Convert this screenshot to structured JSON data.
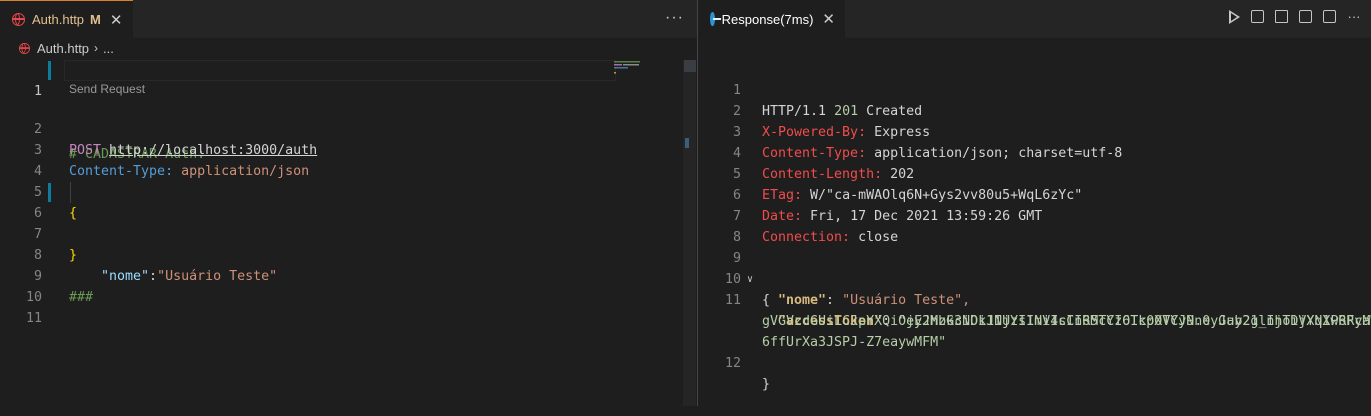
{
  "left": {
    "tab": {
      "label": "Auth.http",
      "modified": "M",
      "close": "✕"
    },
    "more": "···",
    "breadcrumb": {
      "file": "Auth.http",
      "sep": "›",
      "more": "..."
    },
    "codelens": "Send Request",
    "lines": {
      "n1": "1",
      "n2": "2",
      "n3": "3",
      "n4": "4",
      "n5": "5",
      "n6": "6",
      "n7": "7",
      "n8": "8",
      "n9": "9",
      "n10": "10",
      "n11": "11",
      "comment": "# CADASTRAR Auth:",
      "method": "POST",
      "url": "http://localhost:3000/auth",
      "header_key": "Content-Type:",
      "header_value": "application/json",
      "open_brace": "{",
      "body_key": "\"nome\"",
      "body_colon": ":",
      "body_value": "\"Usuário Teste\"",
      "close_brace": "}",
      "separator": "###"
    }
  },
  "right": {
    "tab": {
      "label": "Response(7ms)",
      "close": "✕"
    },
    "lines": {
      "n1": "1",
      "n2": "2",
      "n3": "3",
      "n4": "4",
      "n5": "5",
      "n6": "6",
      "n7": "7",
      "n8": "8",
      "n9": "9",
      "n10": "10",
      "n11": "11",
      "n12": "12",
      "status_proto": "HTTP/1.1",
      "status_code": "201",
      "status_text": "Created",
      "h1_key": "X-Powered-By:",
      "h1_val": "Express",
      "h2_key": "Content-Type:",
      "h2_val": "application/json; charset=utf-8",
      "h3_key": "Content-Length:",
      "h3_val": "202",
      "h4_key": "ETag:",
      "h4_val": "W/\"ca-mWAOlq6N+Gys2vv80u5+WqL6zYc\"",
      "h5_key": "Date:",
      "h5_val": "Fri, 17 Dec 2021 13:59:26 GMT",
      "h6_key": "Connection:",
      "h6_val": "close",
      "open_brace": "{",
      "nome_key": "\"nome\"",
      "nome_val": "\"Usuário Teste\",",
      "token_key": "\"accessToken\"",
      "token_line1": "\"eyJhbGciOiJIUzI1NiIsInR5cCI6IkpXVCJ9.eyJub21lIjoiVXN1w6FyaW8",
      "token_line2": "gVGVzdGUiLCJpYXQiOjE2Mzk3NDk1NjYsImV4cCI6MTYzOTc0OTYyNn0.Gay2g_nhTDjYqXPRRcMyF",
      "token_line3": "6ffUrXa3JSPJ-Z7eaywMFM\"",
      "colon_space": ": ",
      "close_brace": "}"
    }
  }
}
